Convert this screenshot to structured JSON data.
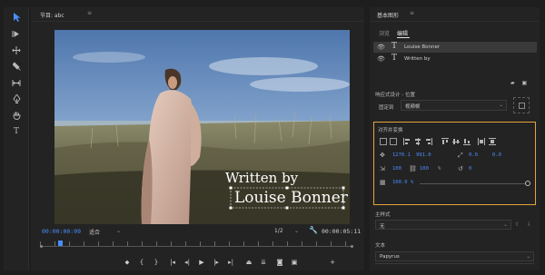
{
  "program_monitor": {
    "title": "节目: abc",
    "menu_icon": "≡",
    "timecode_current": "00:00:00:09",
    "fit": "适合",
    "resolution": "1/2",
    "timecode_duration": "00:00:05:11",
    "title_overlay": {
      "line1": "Written by",
      "line2": "Louise Bonner"
    }
  },
  "essential_graphics": {
    "title": "基本图形",
    "menu_icon": "≡",
    "tabs": [
      {
        "label": "浏览"
      },
      {
        "label": "编辑"
      }
    ],
    "layers": [
      {
        "name": "Louise Bonner"
      },
      {
        "name": "Written by"
      }
    ],
    "responsive_title": "响应式设计 - 位置",
    "pin_label": "固定到",
    "pin_value": "视频帧",
    "align_title": "对齐并变换",
    "position_x": "1270.1",
    "position_y": "991.0",
    "anchor_x": "0.0",
    "anchor_y": "0.0",
    "scale": "100",
    "scale_second": "100",
    "scale_unit": "%",
    "rotation": "0",
    "opacity": "100.0 %",
    "master_style_title": "主样式",
    "master_style_value": "无",
    "text_title": "文本",
    "font_value": "Papyrus"
  },
  "colors": {
    "accent": "#4a8fff",
    "highlight_border": "#e3a33b",
    "panel_bg": "#232323"
  }
}
